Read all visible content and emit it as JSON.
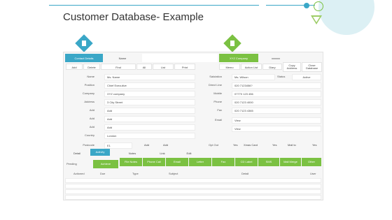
{
  "title": "Customer Database- Example",
  "colors": {
    "accent_blue": "#3aa7c7",
    "accent_green": "#7bc142"
  },
  "icons": {
    "contact_icon": "contact-card-icon",
    "company_icon": "building-icon"
  },
  "top_tabs": {
    "contact_details": "Contact Details",
    "name": "Name",
    "xyz_company": "XYZ Company",
    "blank": "xxxxxx"
  },
  "toolbar_left": [
    "Add",
    "Delete",
    "Find",
    "All",
    "List",
    "Print"
  ],
  "toolbar_right": [
    "Memo",
    "Action List",
    "Diary",
    "Copy Address",
    "Close Database"
  ],
  "left_fields": [
    {
      "label": "Name",
      "value": "Ms. Name"
    },
    {
      "label": "Position",
      "value": "Chief Executive"
    },
    {
      "label": "Company",
      "value": "XYZ company"
    },
    {
      "label": "Address",
      "value": "3 City Street"
    },
    {
      "label": "Add",
      "value": "Add"
    },
    {
      "label": "Add",
      "value": "Add"
    },
    {
      "label": "Add",
      "value": "Add"
    },
    {
      "label": "Country",
      "value": "London"
    }
  ],
  "postcode": {
    "label": "Postcode",
    "value": "E1",
    "add1": "Add",
    "add2": "Add"
  },
  "right_fields": [
    {
      "label": "Salutation",
      "value": "Ms. Wilson"
    },
    {
      "label": "Direct Line",
      "value": "020 7123456?"
    },
    {
      "label": "Mobile",
      "value": "07770 123 456"
    },
    {
      "label": "Phone",
      "value": "020 7123 4000"
    },
    {
      "label": "Fax",
      "value": "020 7123 4365"
    },
    {
      "label": "Email",
      "value": "View"
    },
    {
      "label": "",
      "value": "View"
    }
  ],
  "status": {
    "label": "Status",
    "value": "Active"
  },
  "opt_out": {
    "label": "Opt Out",
    "yes1": "Yes",
    "xmas_card": "Xmas Card",
    "yes2": "Yes",
    "mail_to": "Mail to",
    "yes3": "Yes"
  },
  "detail_tabs": [
    "Detail",
    "Activity",
    "Notes",
    "Link",
    "Edit"
  ],
  "pending": {
    "label": "Pending",
    "value": "Achieve"
  },
  "action_buttons": [
    "File Notes",
    "Phone Call",
    "Email",
    "Letter",
    "Fax",
    "CD Label",
    "SMS",
    "Mail Merge",
    "Other"
  ],
  "table": {
    "columns": [
      "Actioned",
      "Due",
      "Type",
      "Subject",
      "Detail",
      "User"
    ],
    "empty_rows": 4
  }
}
